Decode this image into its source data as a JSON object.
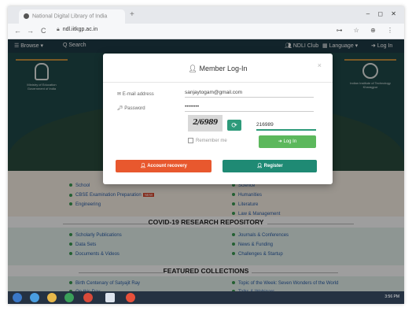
{
  "browser": {
    "tab_title": "National Digital Library of India",
    "new_tab": "+",
    "window_controls": "– ◻ ✕",
    "url": "ndl.iitkgp.ac.in",
    "back": "←",
    "forward": "→",
    "reload": "C",
    "icons": "⊶ ☆ ⊕ ⋮"
  },
  "header": {
    "browse": "☰ Browse ▾",
    "search": "Q Search",
    "club": "NDLI Club",
    "language": "Language ▾",
    "login": "Log In"
  },
  "hero": {
    "left_badge_line1": "Ministry of Education",
    "left_badge_line2": "Government of India",
    "right_badge_line1": "Indian Institute of Technology",
    "right_badge_line2": "Kharagpur"
  },
  "sections": {
    "top_items_left": [
      "School",
      "CBSE Examination Preparation",
      "Engineering"
    ],
    "top_items_right": [
      "Science",
      "Humanities",
      "Literature",
      "Law & Management"
    ],
    "new_badge": "NEW",
    "covid_heading": "COVID-19 RESEARCH REPOSITORY",
    "covid_left": [
      "Scholarly Publications",
      "Data Sets",
      "Documents & Videos"
    ],
    "covid_right": [
      "Journals & Conferences",
      "News & Funding",
      "Challenges & Startup"
    ],
    "featured_heading": "FEATURED COLLECTIONS",
    "featured_left": [
      "Birth Centenary of Satyajit Ray",
      "On this Day"
    ],
    "featured_right": [
      "Topic of the Week: Seven Wonders of the World",
      "Talks & Webinars"
    ]
  },
  "modal": {
    "title": "Member Log-In",
    "close": "×",
    "email_label": "E-mail address",
    "email_value": "sanjaytogam@gmail.com",
    "password_label": "Password",
    "password_value": "••••••••",
    "captcha_text": "2/6989",
    "captcha_input": "216989",
    "refresh_icon": "⟳",
    "remember_label": "Remember me",
    "login_button": "Log In",
    "account_recovery_button": "Account recovery",
    "register_button": "Register"
  },
  "taskbar": {
    "clock": "3:56 PM"
  },
  "colors": {
    "nav_bg": "#1d3a46",
    "login_green": "#5cb85c",
    "recovery_orange": "#e8582e",
    "register_teal": "#1f8a74",
    "link_blue": "#2a5ea8"
  }
}
